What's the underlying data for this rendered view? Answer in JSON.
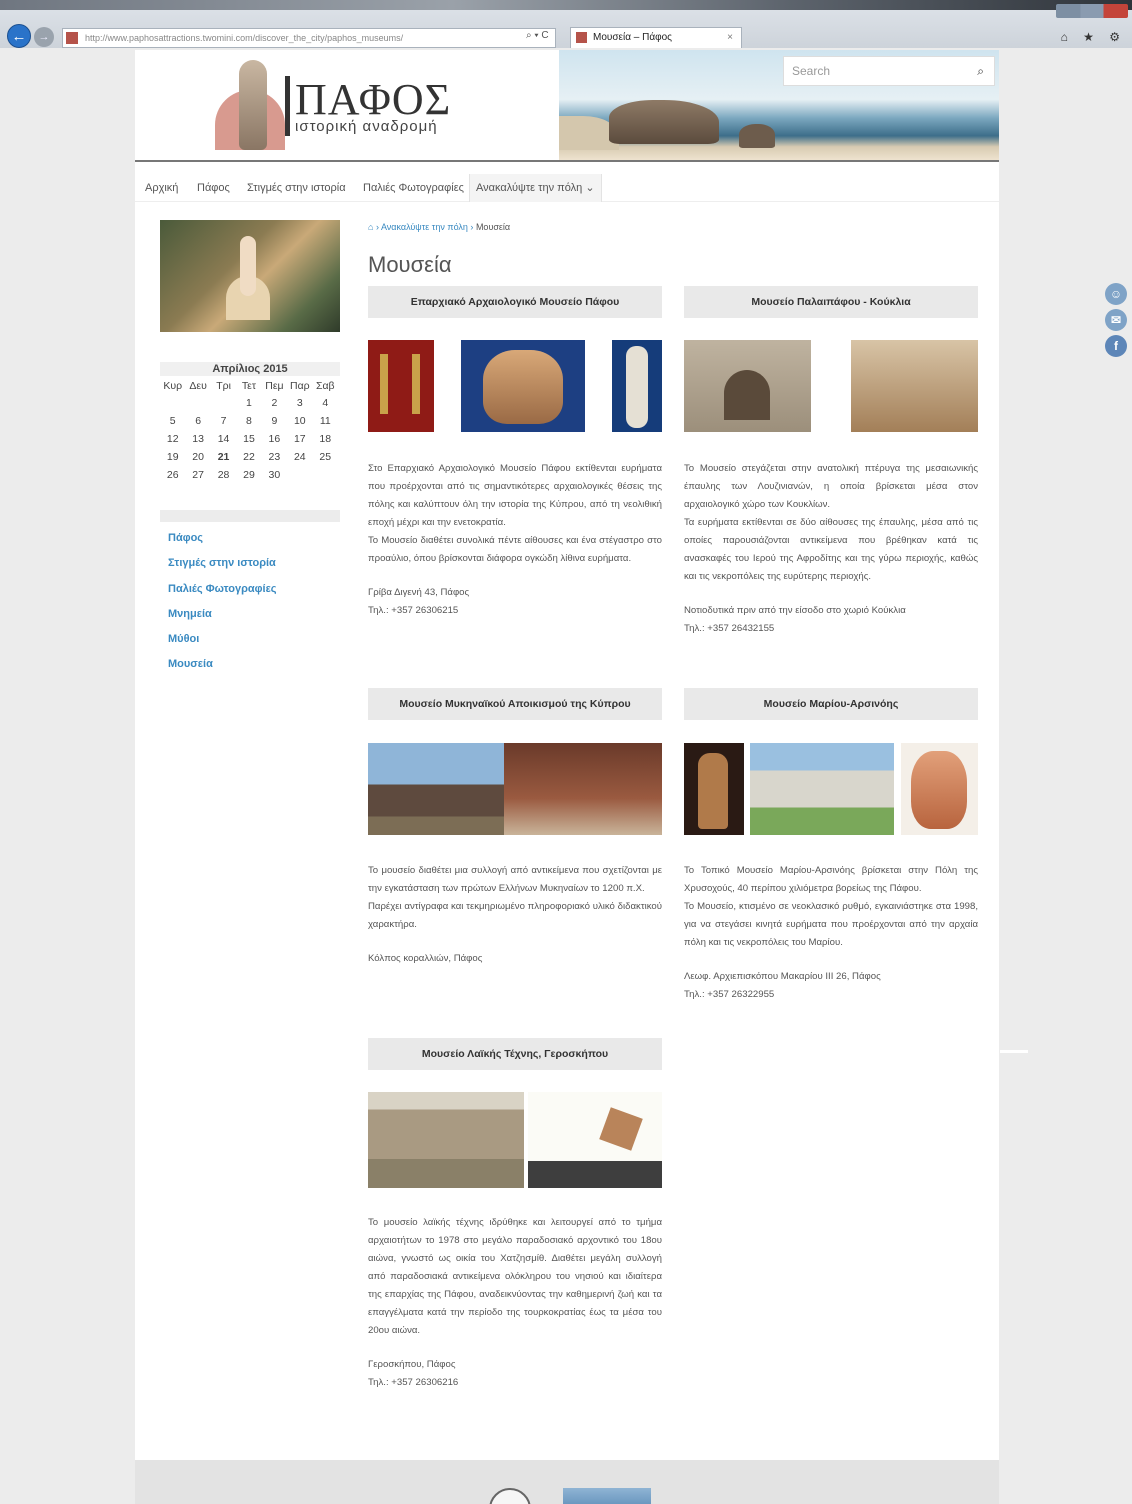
{
  "browser": {
    "address": "http://www.paphosattractions.twomini.com/discover_the_city/paphos_museums/",
    "address_tools": "⌕ ▾ C",
    "tab_title": "Μουσεία – Πάφος",
    "tab_close": "×",
    "back": "←",
    "forward": "→",
    "right_icons": "⌂ ★ ⚙"
  },
  "header": {
    "logo_title": "ΠΑΦΟΣ",
    "logo_subtitle": "ιστορική αναδρομή",
    "search_placeholder": "Search",
    "search_icon": "⌕"
  },
  "nav": {
    "items": [
      "Αρχική",
      "Πάφος",
      "Στιγμές στην ιστορία",
      "Παλιές Φωτογραφίες",
      "Ανακαλύψτε την πόλη ⌄"
    ]
  },
  "sidebar": {
    "calendar": {
      "title": "Απρίλιος 2015",
      "weekdays": [
        "Κυρ",
        "Δευ",
        "Τρι",
        "Τετ",
        "Πεμ",
        "Παρ",
        "Σαβ"
      ],
      "rows": [
        [
          "",
          "",
          "",
          "1",
          "2",
          "3",
          "4"
        ],
        [
          "5",
          "6",
          "7",
          "8",
          "9",
          "10",
          "11"
        ],
        [
          "12",
          "13",
          "14",
          "15",
          "16",
          "17",
          "18"
        ],
        [
          "19",
          "20",
          "21",
          "22",
          "23",
          "24",
          "25"
        ],
        [
          "26",
          "27",
          "28",
          "29",
          "30",
          "",
          ""
        ]
      ],
      "today": "21"
    },
    "links": [
      "Πάφος",
      "Στιγμές στην ιστορία",
      "Παλιές Φωτογραφίες",
      "Μνημεία",
      "Μύθοι",
      "Μουσεία"
    ]
  },
  "breadcrumb": {
    "home_icon": "⌂",
    "sep": "›",
    "parent": "Ανακαλύψτε την πόλη",
    "current": "Μουσεία"
  },
  "page_title": "Μουσεία",
  "museums": [
    {
      "title": "Επαρχιακό Αρχαιολογικό Μουσείο Πάφου",
      "paragraphs": [
        "Στο Επαρχιακό Αρχαιολογικό Μουσείο Πάφου εκτίθενται ευρήματα που προέρχονται από τις σημαντικότερες αρχαιολογικές θέσεις της πόλης και καλύπτουν όλη την ιστορία της Κύπρου, από τη νεολιθική εποχή μέχρι και την ενετοκρατία.",
        "Το Μουσείο διαθέτει συνολικά πέντε αίθουσες και ένα στέγαστρο στο προαύλιο, όπου βρίσκονται διάφορα ογκώδη λίθινα ευρήματα."
      ],
      "address": "Γρίβα Διγενή 43, Πάφος",
      "phone": "Τηλ.: +357 26306215"
    },
    {
      "title": "Μουσείο Παλαιπάφου - Κούκλια",
      "paragraphs": [
        "Το Μουσείο στεγάζεται στην ανατολική πτέρυγα της μεσαιωνικής έπαυλης των Λουζινιανών, η οποία βρίσκεται μέσα στον αρχαιολογικό χώρο των Κουκλίων.",
        "Τα ευρήματα εκτίθενται σε δύο αίθουσες της έπαυλης, μέσα από τις οποίες παρουσιάζονται αντικείμενα που βρέθηκαν κατά τις ανασκαφές του Ιερού της Αφροδίτης και της γύρω περιοχής, καθώς και τις νεκροπόλεις της ευρύτερης περιοχής."
      ],
      "address": "Νοτιοδυτικά πριν από την είσοδο στο χωριό Κούκλια",
      "phone": "Τηλ.: +357 26432155"
    },
    {
      "title": "Μουσείο Μυκηναϊκού Αποικισμού της Κύπρου",
      "paragraphs": [
        "Το μουσείο διαθέτει μια συλλογή από αντικείμενα που σχετίζονται με την εγκατάσταση των πρώτων Ελλήνων Μυκηναίων το 1200 π.Χ.",
        "Παρέχει αντίγραφα και τεκμηριωμένο πληροφοριακό υλικό διδακτικού χαρακτήρα."
      ],
      "address": "Κόλπος κοραλλιών, Πάφος",
      "phone": ""
    },
    {
      "title": "Μουσείο Μαρίου-Αρσινόης",
      "paragraphs": [
        "Το Τοπικό Μουσείο Μαρίου-Αρσινόης βρίσκεται στην Πόλη της Χρυσοχούς, 40 περίπου χιλιόμετρα βορείως της Πάφου.",
        "Το Μουσείο, κτισμένο σε νεοκλασικό ρυθμό, εγκαινιάστηκε στα 1998, για να στεγάσει κινητά ευρήματα που προέρχονται από την αρχαία πόλη και τις νεκροπόλεις του Μαρίου."
      ],
      "address": "Λεωφ. Αρχιεπισκόπου Μακαρίου ΙΙΙ 26, Πάφος",
      "phone": "Τηλ.: +357 26322955"
    },
    {
      "title": "Μουσείο Λαϊκής Τέχνης, Γεροσκήπου",
      "paragraphs": [
        "Το μουσείο λαϊκής τέχνης ιδρύθηκε και λειτουργεί από το τμήμα αρχαιοτήτων το 1978 στο μεγάλο παραδοσιακό αρχοντικό του 18ου αιώνα, γνωστό ως οικία του Χατζησμίθ. Διαθέτει μεγάλη συλλογή από παραδοσιακά αντικείμενα ολόκληρου του νησιού και ιδιαίτερα της επαρχίας της Πάφου, αναδεικνύοντας την καθημερινή ζωή και τα επαγγέλματα κατά την περίοδο της τουρκοκρατίας έως τα μέσα του 20ου αιώνα."
      ],
      "address": "Γεροσκήπου, Πάφος",
      "phone": "Τηλ.: +357 26306216"
    }
  ],
  "social_icons": [
    "person-icon",
    "mail-icon",
    "facebook-icon"
  ],
  "social_glyphs": [
    "☺",
    "✉",
    "f"
  ]
}
